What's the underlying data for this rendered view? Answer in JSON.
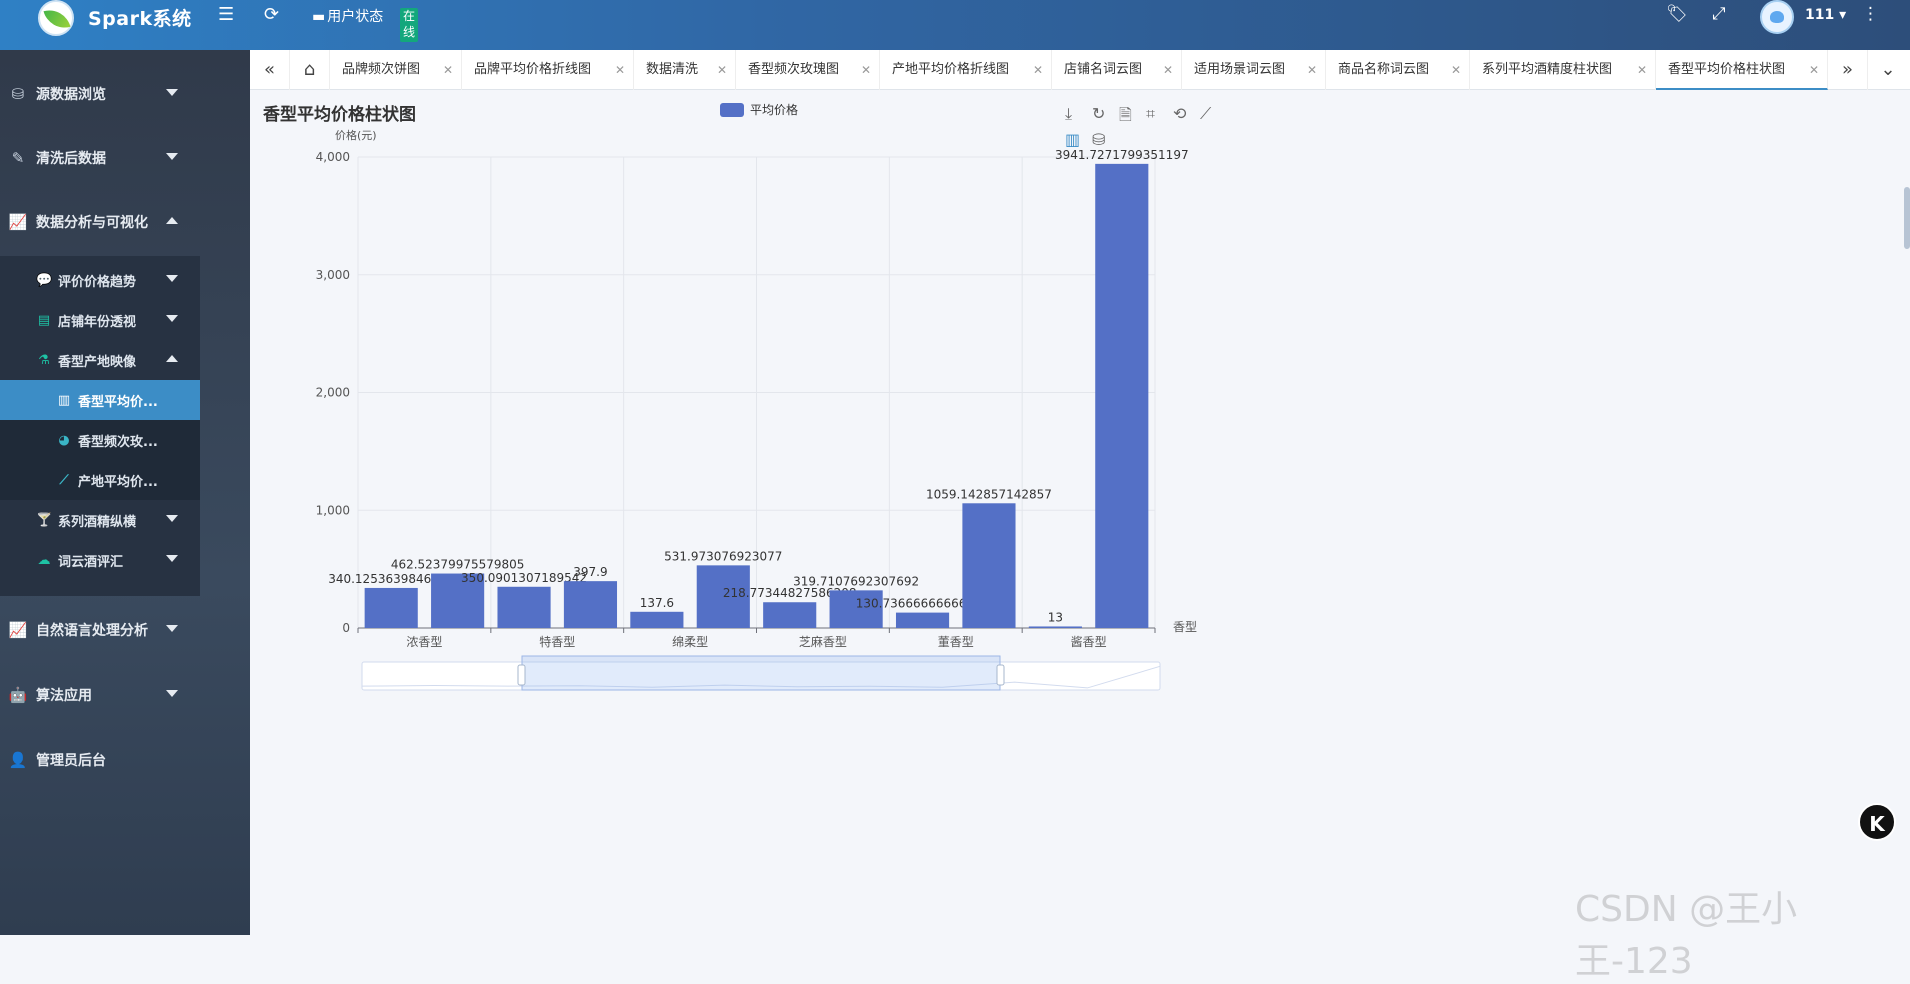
{
  "app": {
    "title": "Spark系统",
    "user_status_label": "用户状态",
    "status_badge": "在线",
    "username": "111"
  },
  "sidebar": {
    "items": [
      {
        "label": "源数据浏览",
        "icon": "database-icon"
      },
      {
        "label": "清洗后数据",
        "icon": "broom-icon"
      },
      {
        "label": "数据分析与可视化",
        "icon": "line-chart-icon"
      },
      {
        "label": "自然语言处理分析",
        "icon": "line-chart-icon"
      },
      {
        "label": "算法应用",
        "icon": "robot-icon"
      },
      {
        "label": "管理员后台",
        "icon": "admin-user-icon"
      }
    ],
    "submenu": [
      {
        "label": "评价价格趋势",
        "icon": "comment-icon"
      },
      {
        "label": "店铺年份透视",
        "icon": "store-icon"
      },
      {
        "label": "香型产地映像",
        "icon": "bottle-icon"
      },
      {
        "label": "系列酒精纵横",
        "icon": "glass-icon"
      },
      {
        "label": "词云酒评汇",
        "icon": "cloud-icon"
      }
    ],
    "subsub": [
      {
        "label": "香型平均价...",
        "icon": "bar-chart-icon"
      },
      {
        "label": "香型频次玫...",
        "icon": "pie-chart-icon"
      },
      {
        "label": "产地平均价...",
        "icon": "line-chart-icon"
      }
    ]
  },
  "tabs": [
    "品牌频次饼图",
    "品牌平均价格折线图",
    "数据清洗",
    "香型频次玫瑰图",
    "产地平均价格折线图",
    "店铺名词云图",
    "适用场景词云图",
    "商品名称词云图",
    "系列平均酒精度柱状图",
    "香型平均价格柱状图"
  ],
  "watermark": "CSDN @王小王-123",
  "k_badge": "K",
  "chart_data": {
    "type": "bar",
    "title": "香型平均价格柱状图",
    "legend": "平均价格",
    "ylabel": "价格(元)",
    "xlabel": "香型",
    "ylim": [
      0,
      4000
    ],
    "yticks": [
      "0",
      "1,000",
      "2,000",
      "3,000",
      "4,000"
    ],
    "x_tick_labels": [
      "浓香型",
      "特香型",
      "绵柔型",
      "芝麻香型",
      "董香型",
      "酱香型"
    ],
    "color": "#5470c6",
    "values": [
      340.1253639846743,
      462.52379975579805,
      350.0901307189542,
      397.9,
      137.6,
      531.973076923077,
      218.77344827586208,
      319.7107692307692,
      130.73666666666665,
      1059.142857142857,
      13,
      3941.7271799351197
    ],
    "labels": [
      "340.1253639846743",
      "462.52379975579805",
      "350.0901307189542",
      "397.9",
      "137.6",
      "531.973076923077",
      "218.77344827586208",
      "319.7107692307692",
      "130.73666666666665",
      "1059.142857142857",
      "13",
      "3941.7271799351197"
    ],
    "grid": true
  }
}
